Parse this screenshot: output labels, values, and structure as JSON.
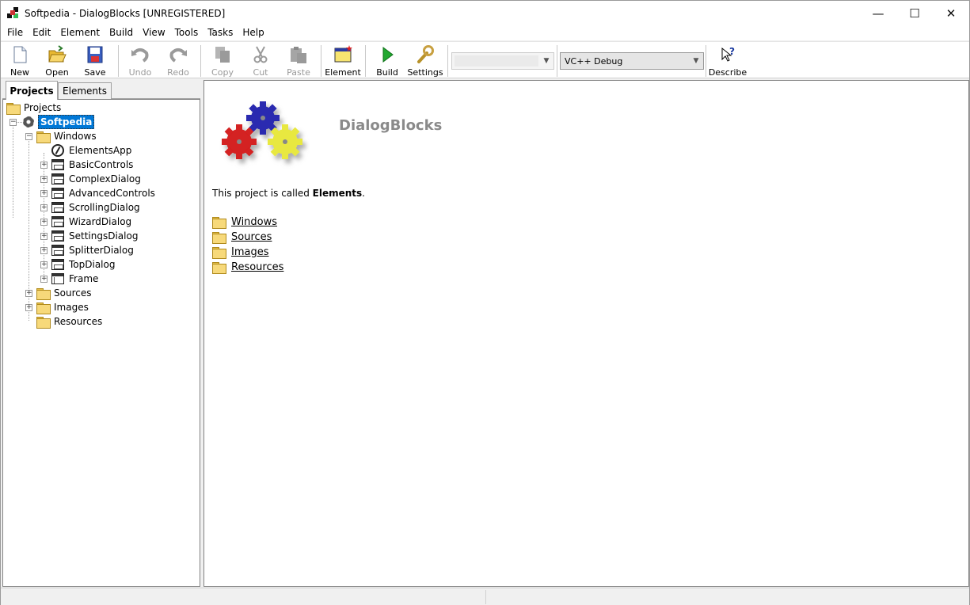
{
  "window": {
    "title": "Softpedia - DialogBlocks [UNREGISTERED]",
    "controls": {
      "minimize": "—",
      "maximize": "☐",
      "close": "✕"
    }
  },
  "menu": [
    "File",
    "Edit",
    "Element",
    "Build",
    "View",
    "Tools",
    "Tasks",
    "Help"
  ],
  "toolbar": {
    "new": "New",
    "open": "Open",
    "save": "Save",
    "undo": "Undo",
    "redo": "Redo",
    "copy": "Copy",
    "cut": "Cut",
    "paste": "Paste",
    "element": "Element",
    "build": "Build",
    "settings": "Settings",
    "config_value": "VC++ Debug",
    "describe": "Describe"
  },
  "left_tabs": {
    "projects": "Projects",
    "elements": "Elements"
  },
  "tree": {
    "root": "Projects",
    "project": "Softpedia",
    "windows": "Windows",
    "items": [
      "ElementsApp",
      "BasicControls",
      "ComplexDialog",
      "AdvancedControls",
      "ScrollingDialog",
      "WizardDialog",
      "SettingsDialog",
      "SplitterDialog",
      "TopDialog",
      "Frame"
    ],
    "sources": "Sources",
    "images": "Images",
    "resources": "Resources"
  },
  "content": {
    "heading": "DialogBlocks",
    "intro_prefix": "This project is called ",
    "intro_name": "Elements",
    "intro_suffix": ".",
    "links": [
      "Windows",
      "Sources",
      "Images",
      "Resources"
    ]
  },
  "colors": {
    "selection": "#0078d7",
    "gear_red": "#d42020",
    "gear_blue": "#2a2ab0",
    "gear_yellow": "#e8e840"
  }
}
